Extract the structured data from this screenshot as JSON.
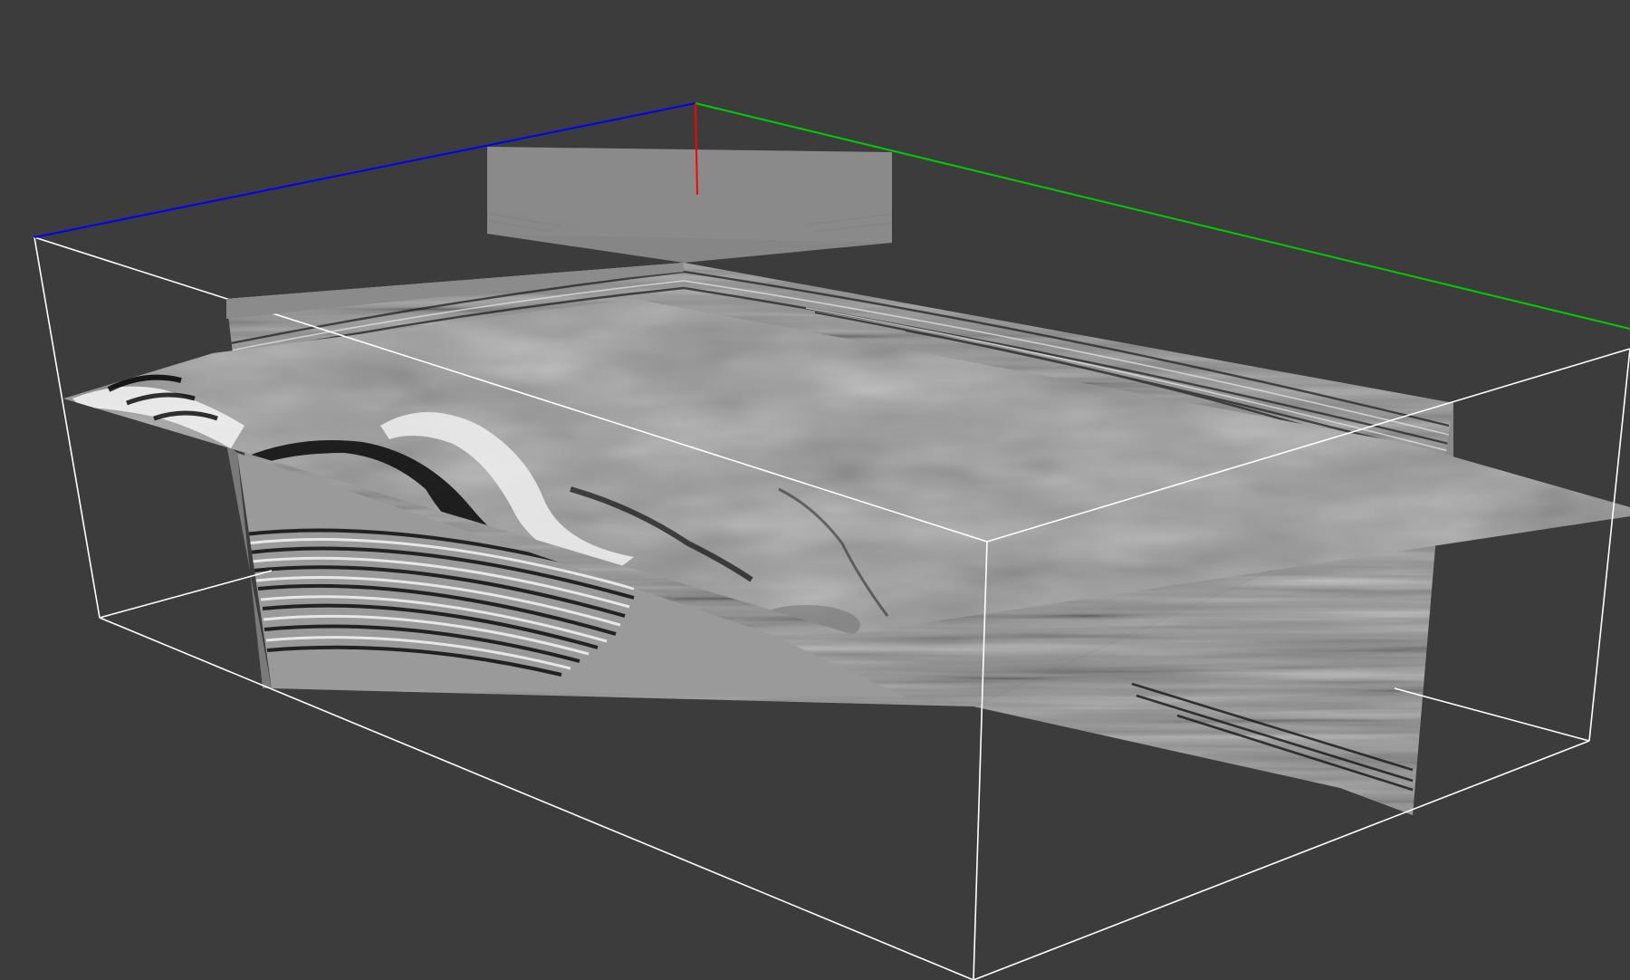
{
  "viewer": {
    "background_color": "#3c3c3c",
    "axis_colors": {
      "x": "#0000ff",
      "y": "#00cc00",
      "z": "#ff0000"
    },
    "bounding_box_color": "#ffffff",
    "slices": [
      {
        "name": "inline-slice",
        "orientation": "vertical"
      },
      {
        "name": "crossline-slice",
        "orientation": "vertical"
      },
      {
        "name": "time-slice",
        "orientation": "horizontal"
      }
    ],
    "colormap": "grayscale"
  }
}
